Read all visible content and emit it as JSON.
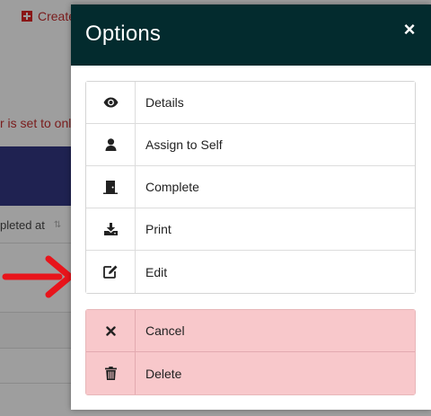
{
  "background": {
    "create_label": "Create",
    "notice_text": "r is set to onl",
    "column_header": "pleted at",
    "sort_glyph": "⇅"
  },
  "modal": {
    "title": "Options",
    "close_glyph": "×",
    "options": [
      {
        "label": "Details",
        "icon": "eye-icon"
      },
      {
        "label": "Assign to Self",
        "icon": "user-icon"
      },
      {
        "label": "Complete",
        "icon": "door-icon"
      },
      {
        "label": "Print",
        "icon": "download-icon"
      },
      {
        "label": "Edit",
        "icon": "edit-icon"
      }
    ],
    "danger_options": [
      {
        "label": "Cancel",
        "icon": "times-icon"
      },
      {
        "label": "Delete",
        "icon": "trash-icon"
      }
    ]
  },
  "colors": {
    "header_bg": "#032b2e",
    "danger_bg": "#f8c8cb",
    "annotation_arrow": "#e8141b",
    "overlay": "#9e9e9e"
  }
}
